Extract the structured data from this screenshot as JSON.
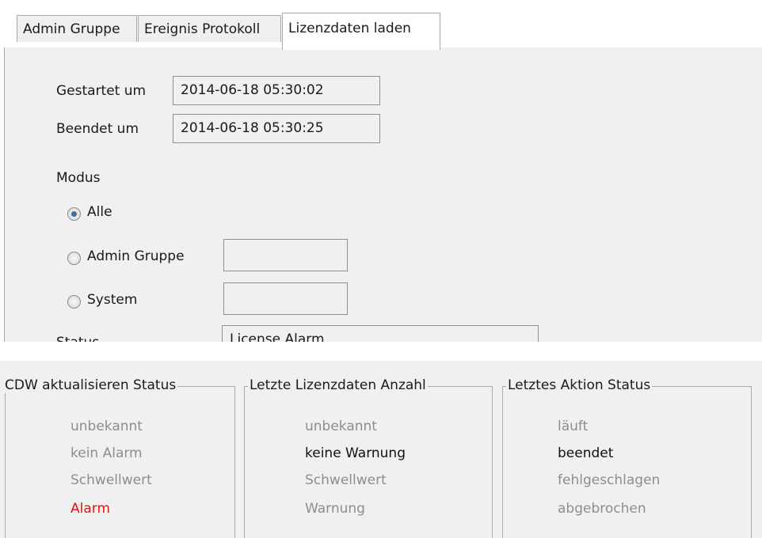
{
  "tabs": [
    "Admin Gruppe",
    "Ereignis Protokoll",
    "Lizenzdaten laden"
  ],
  "form": {
    "started_label": "Gestartet um",
    "started_value": "2014-06-18 05:30:02",
    "ended_label": "Beendet um",
    "ended_value": "2014-06-18 05:30:25",
    "mode_label": "Modus",
    "mode_options": [
      "Alle",
      "Admin Gruppe",
      "System"
    ],
    "mode_selected": "Alle",
    "admin_group_value": "",
    "system_value": "",
    "status_label": "Status",
    "status_value": "License Alarm"
  },
  "groups": [
    {
      "title": "CDW aktualisieren Status",
      "items": [
        "unbekannt",
        "kein Alarm",
        "Schwellwert",
        "Alarm"
      ],
      "highlighted": "Alarm",
      "highlight_color": "#e8110f"
    },
    {
      "title": "Letzte Lizenzdaten Anzahl",
      "items": [
        "unbekannt",
        "keine Warnung",
        "Schwellwert",
        "Warnung"
      ],
      "highlighted": "keine Warnung",
      "highlight_color": "#111111"
    },
    {
      "title": "Letztes Aktion Status",
      "items": [
        "läuft",
        "beendet",
        "fehlgeschlagen",
        "abgebrochen"
      ],
      "highlighted": "beendet",
      "highlight_color": "#111111"
    }
  ],
  "colors": {
    "inactive_text": "#8d8d8d",
    "panel_bg": "#f0f0f0",
    "radio_dot": "#3a6ea5"
  }
}
